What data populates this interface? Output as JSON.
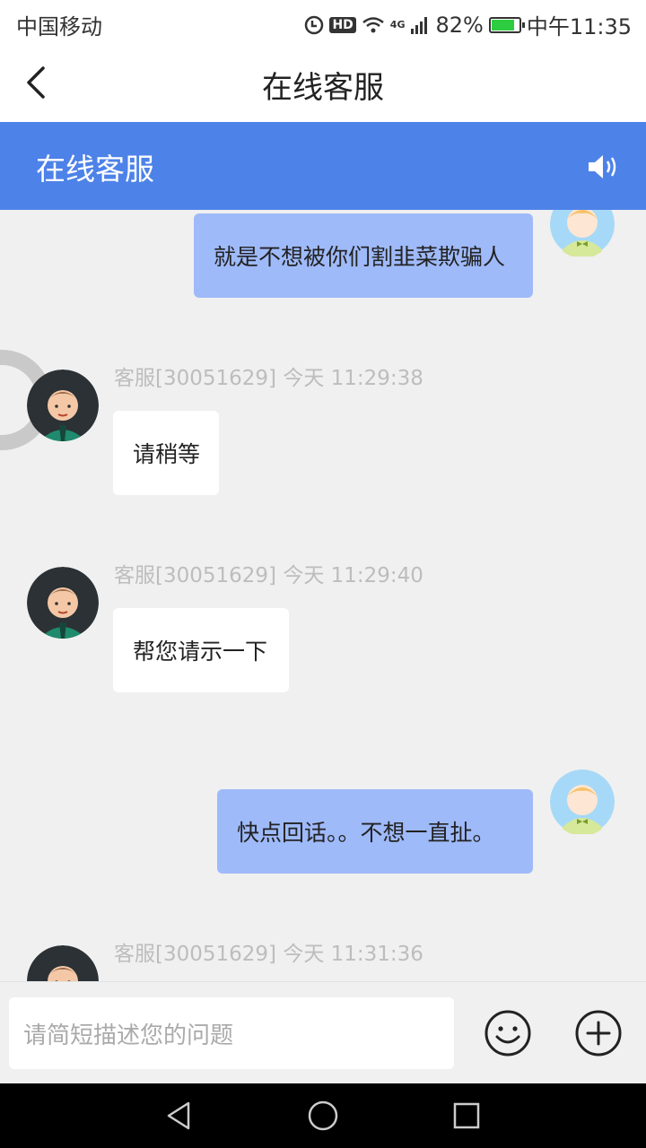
{
  "status_bar": {
    "carrier": "中国移动",
    "hd": "HD",
    "network": "4G",
    "battery": "82%",
    "battery_level": 0.82,
    "time": "中午11:35"
  },
  "header": {
    "title": "在线客服"
  },
  "banner": {
    "title": "在线客服"
  },
  "messages": [
    {
      "from": "me",
      "text": "就是不想被你们割韭菜欺骗人"
    },
    {
      "from": "agent",
      "meta": "客服[30051629]  今天 11:29:38",
      "text": "请稍等"
    },
    {
      "from": "agent",
      "meta": "客服[30051629]  今天 11:29:40",
      "text": "帮您请示一下"
    },
    {
      "from": "me",
      "text": "快点回话。。不想一直扯。"
    },
    {
      "from": "agent",
      "meta": "客服[30051629]  今天 11:31:36",
      "text": ""
    }
  ],
  "input": {
    "placeholder": "请简短描述您的问题"
  },
  "colors": {
    "banner": "#4d82e8",
    "my_bubble": "#9fbaf9",
    "agent_bubble": "#ffffff",
    "background": "#f0f0f0"
  }
}
